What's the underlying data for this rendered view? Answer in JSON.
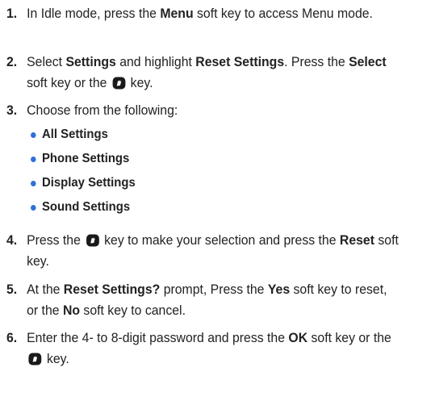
{
  "steps": [
    {
      "number": "1.",
      "parts": [
        "In Idle mode, press the ",
        "Menu",
        " soft key to access Menu mode."
      ]
    },
    {
      "number": "2.",
      "parts": [
        "Select ",
        "Settings",
        " and highlight ",
        "Reset Settings",
        ". Press the ",
        "Select",
        " soft key or the ",
        " key."
      ]
    },
    {
      "number": "3.",
      "parts": [
        "Choose from the following:"
      ]
    },
    {
      "number": "4.",
      "parts": [
        "Press the ",
        " key to make your selection and press the ",
        "Reset",
        " soft key."
      ]
    },
    {
      "number": "5.",
      "parts": [
        "At the ",
        "Reset Settings?",
        " prompt, Press the ",
        "Yes",
        " soft key to reset, or the ",
        "No",
        " soft key to cancel."
      ]
    },
    {
      "number": "6.",
      "parts": [
        "Enter the 4- to 8-digit password and press the ",
        "OK",
        " soft key or the ",
        " key."
      ]
    }
  ],
  "options": [
    "All Settings",
    "Phone Settings",
    "Display Settings",
    "Sound Settings"
  ],
  "icons": {
    "key": "info-key-icon",
    "bullet": "bullet-dot"
  },
  "colors": {
    "text": "#222222",
    "bullet": "#2f6fd6"
  }
}
